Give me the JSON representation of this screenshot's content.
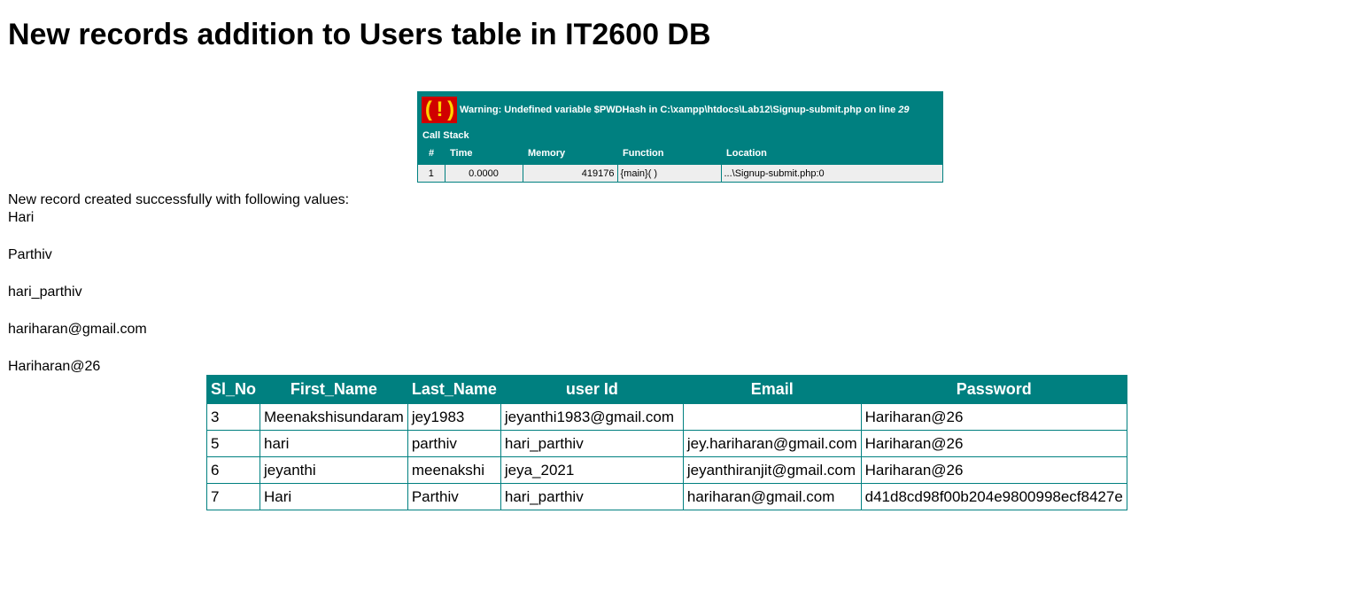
{
  "page": {
    "title": "New records addition to Users table in IT2600 DB"
  },
  "warning": {
    "icon": "( ! )",
    "message": "Warning: Undefined variable $PWDHash in C:\\xampp\\htdocs\\Lab12\\Signup-submit.php on line ",
    "line": "29",
    "call_stack_label": "Call Stack",
    "columns": [
      "#",
      "Time",
      "Memory",
      "Function",
      "Location"
    ],
    "row": {
      "num": "1",
      "time": "0.0000",
      "memory": "419176",
      "function": "{main}( )",
      "location": "...\\Signup-submit.php:0"
    }
  },
  "result": {
    "message": "New record created successfully with following values:",
    "values": [
      "Hari",
      "Parthiv",
      "hari_parthiv",
      "hariharan@gmail.com",
      "Hariharan@26"
    ]
  },
  "users_table": {
    "headers": [
      "Sl_No",
      "First_Name",
      "Last_Name",
      "user Id",
      "Email",
      "Password"
    ],
    "rows": [
      [
        "3",
        "Meenakshisundaram",
        "jey1983",
        "jeyanthi1983@gmail.com",
        "",
        "Hariharan@26"
      ],
      [
        "5",
        "hari",
        "parthiv",
        "hari_parthiv",
        "jey.hariharan@gmail.com",
        "Hariharan@26"
      ],
      [
        "6",
        "jeyanthi",
        "meenakshi",
        "jeya_2021",
        "jeyanthiranjit@gmail.com",
        "Hariharan@26"
      ],
      [
        "7",
        "Hari",
        "Parthiv",
        "hari_parthiv",
        "hariharan@gmail.com",
        "d41d8cd98f00b204e9800998ecf8427e"
      ]
    ]
  },
  "colors": {
    "teal": "#008080",
    "warning_icon_bg": "#d00000",
    "warning_icon_fg": "#ffd200"
  }
}
